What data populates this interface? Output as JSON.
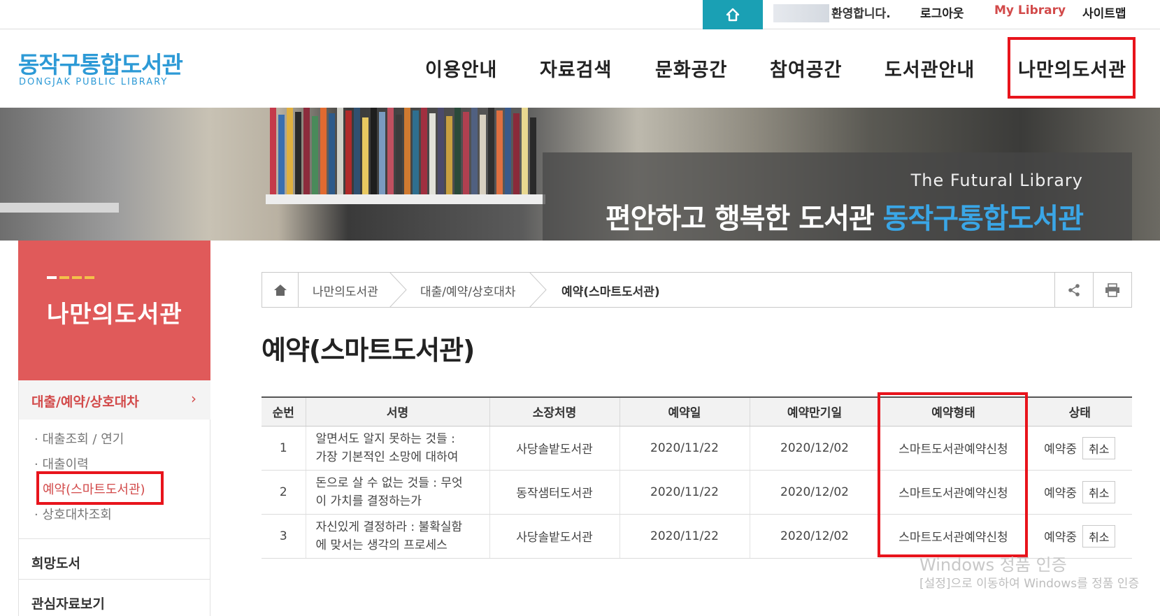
{
  "topbar": {
    "home_icon": "home-icon",
    "welcome": "환영합니다.",
    "logout": "로그아웃",
    "my_library": "My Library",
    "sitemap": "사이트맵"
  },
  "header": {
    "logo_ko": "동작구통합도서관",
    "logo_en": "DONGJAK PUBLIC LIBRARY",
    "nav": [
      "이용안내",
      "자료검색",
      "문화공간",
      "참여공간",
      "도서관안내",
      "나만의도서관"
    ]
  },
  "banner": {
    "subtitle": "The Futural Library",
    "title_main": "편안하고 행복한 도서관 ",
    "title_accent": "동작구통합도서관"
  },
  "sidebar": {
    "title": "나만의도서관",
    "active_section": "대출/예약/상호대차",
    "sub_items": [
      "대출조회 / 연기",
      "대출이력",
      "예약(스마트도서관)",
      "상호대차조회"
    ],
    "sections": [
      "희망도서",
      "관심자료보기"
    ]
  },
  "breadcrumb": {
    "items": [
      "나만의도서관",
      "대출/예약/상호대차",
      "예약(스마트도서관)"
    ],
    "share_icon": "share-icon",
    "print_icon": "print-icon"
  },
  "page": {
    "title": "예약(스마트도서관)"
  },
  "table": {
    "headers": [
      "순번",
      "서명",
      "소장처명",
      "예약일",
      "예약만기일",
      "예약형태",
      "상태"
    ],
    "rows": [
      {
        "no": "1",
        "title_l1": "알면서도 알지 못하는 것들 :",
        "title_l2": "가장 기본적인 소망에 대하여",
        "library": "사당솔밭도서관",
        "reserve_date": "2020/11/22",
        "expire_date": "2020/12/02",
        "type": "스마트도서관예약신청",
        "status": "예약중",
        "cancel": "취소"
      },
      {
        "no": "2",
        "title_l1": "돈으로 살 수 없는 것들 : 무엇",
        "title_l2": "이 가치를 결정하는가",
        "library": "동작샘터도서관",
        "reserve_date": "2020/11/22",
        "expire_date": "2020/12/02",
        "type": "스마트도서관예약신청",
        "status": "예약중",
        "cancel": "취소"
      },
      {
        "no": "3",
        "title_l1": "자신있게 결정하라 : 불확실함",
        "title_l2": "에 맞서는 생각의 프로세스",
        "library": "사당솔밭도서관",
        "reserve_date": "2020/11/22",
        "expire_date": "2020/12/02",
        "type": "스마트도서관예약신청",
        "status": "예약중",
        "cancel": "취소"
      }
    ]
  },
  "watermark": {
    "line1": "Windows 정품 인증",
    "line2": "[설정]으로 이동하여 Windows를 정품 인증"
  },
  "colors": {
    "accent_red": "#d24a4a",
    "highlight": "#e8141c",
    "teal": "#1aa0b4",
    "brand_blue": "#2d9ad6"
  }
}
